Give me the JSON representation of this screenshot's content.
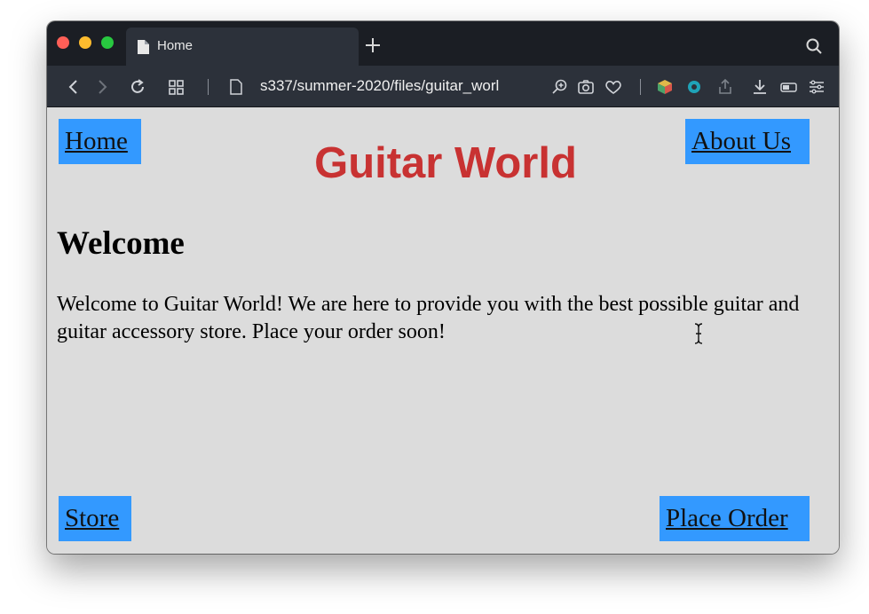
{
  "browser": {
    "tab_title": "Home",
    "url": "s337/summer-2020/files/guitar_worl"
  },
  "page": {
    "site_title": "Guitar World",
    "nav": {
      "home": "Home",
      "about": "About Us",
      "store": "Store",
      "order": "Place Order"
    },
    "heading": "Welcome",
    "body": "Welcome to Guitar World! We are here to provide you with the best possible guitar and guitar accessory store. Place your order soon!"
  },
  "colors": {
    "nav_link_bg": "#3399ff",
    "title_color": "#c83232",
    "page_bg": "#dcdcdc"
  }
}
